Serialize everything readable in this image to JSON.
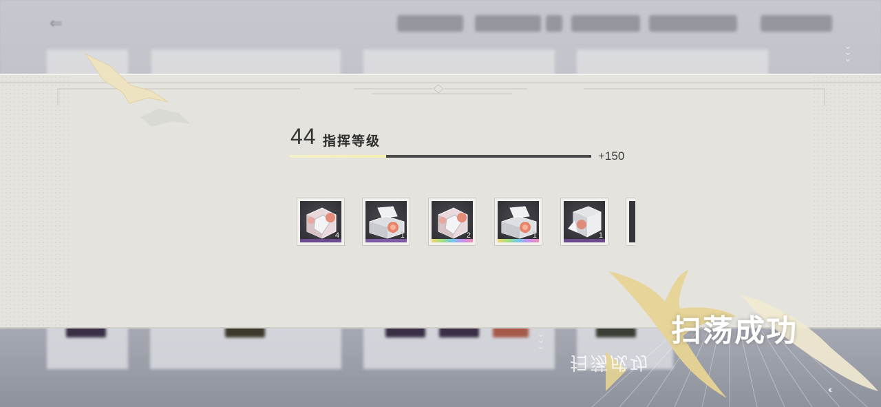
{
  "commander": {
    "level": "44",
    "level_label": "指挥等级",
    "xp_gain": "+150",
    "xp_progress": 0.32,
    "xp_fill_color": "#f4efb8",
    "xp_track_color": "#4a4a4a"
  },
  "rewards": [
    {
      "icon": "heart-crystal-crate-icon",
      "quantity": "4",
      "rarity_color": "#6b4b8f"
    },
    {
      "icon": "open-crystal-box-icon",
      "quantity": "1",
      "rarity_color": "#7d5aa6"
    },
    {
      "icon": "heart-crystal-crate-icon",
      "quantity": "2",
      "rarity": "rainbow"
    },
    {
      "icon": "open-crystal-box-icon",
      "quantity": "1",
      "rarity": "rainbow"
    },
    {
      "icon": "crystal-cube-icon",
      "quantity": "1",
      "rarity_color": "#6a4a8c"
    }
  ],
  "result": {
    "title": "扫荡成功"
  },
  "colors": {
    "banner_bg": "#e4e3de",
    "accent_gold": "#e8d7a3"
  }
}
